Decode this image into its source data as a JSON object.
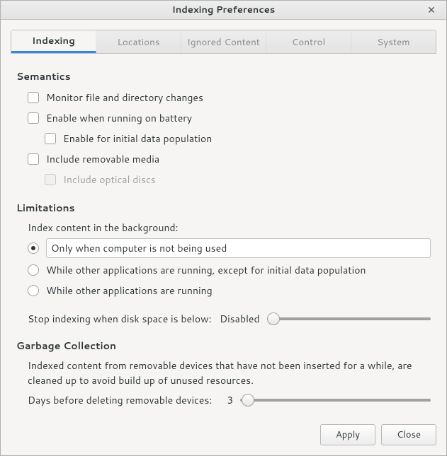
{
  "window": {
    "title": "Indexing Preferences"
  },
  "tabs": [
    {
      "label": "Indexing",
      "active": true
    },
    {
      "label": "Locations",
      "active": false
    },
    {
      "label": "Ignored Content",
      "active": false
    },
    {
      "label": "Control",
      "active": false
    },
    {
      "label": "System",
      "active": false
    }
  ],
  "semantics": {
    "header": "Semantics",
    "monitor": "Monitor file and directory changes",
    "battery": "Enable when running on battery",
    "initial_population": "Enable for initial data population",
    "removable": "Include removable media",
    "optical": "Include optical discs"
  },
  "limitations": {
    "header": "Limitations",
    "bg_label": "Index content in the background:",
    "opts": [
      "Only when computer is not being used",
      "While other applications are running, except for initial data population",
      "While other applications are running"
    ],
    "selected": 0,
    "disk_label": "Stop indexing when disk space is below:",
    "disk_value": "Disabled"
  },
  "gc": {
    "header": "Garbage Collection",
    "explain": "Indexed content from removable devices that have not been inserted for a while, are cleaned up to avoid build up of unused resources.",
    "days_label": "Days before deleting removable devices:",
    "days_value": "3"
  },
  "buttons": {
    "apply": "Apply",
    "close": "Close"
  }
}
